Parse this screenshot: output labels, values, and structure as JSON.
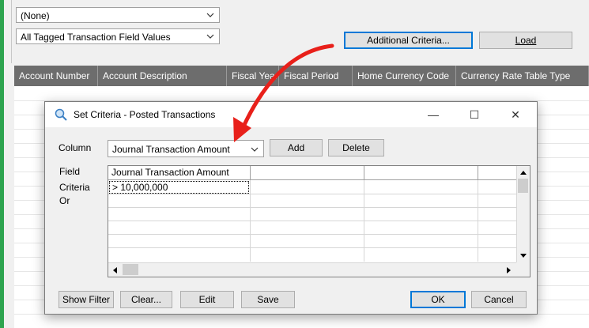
{
  "top_controls": {
    "none_select": "(None)",
    "tagged_select": "All Tagged Transaction Field Values",
    "additional_criteria_label": "Additional Criteria...",
    "load_label": "Load"
  },
  "main_grid": {
    "columns": [
      "Account Number",
      "Account Description",
      "Fiscal Year",
      "Fiscal Period",
      "Home Currency Code",
      "Currency Rate Table Type"
    ]
  },
  "dialog": {
    "title": "Set Criteria - Posted Transactions",
    "column_label": "Column",
    "column_value": "Journal Transaction Amount",
    "add_label": "Add",
    "delete_label": "Delete",
    "row_labels": {
      "field": "Field",
      "criteria": "Criteria",
      "or": "Or"
    },
    "criteria_grid": {
      "header": "Journal Transaction Amount",
      "criteria_value": "> 10,000,000"
    },
    "buttons": {
      "show_filter": "Show Filter",
      "clear": "Clear...",
      "edit": "Edit",
      "save": "Save",
      "ok": "OK",
      "cancel": "Cancel"
    }
  },
  "colors": {
    "annotation_arrow": "#e8201a",
    "accent_green": "#2ea44f",
    "focus_blue": "#0078d7"
  }
}
